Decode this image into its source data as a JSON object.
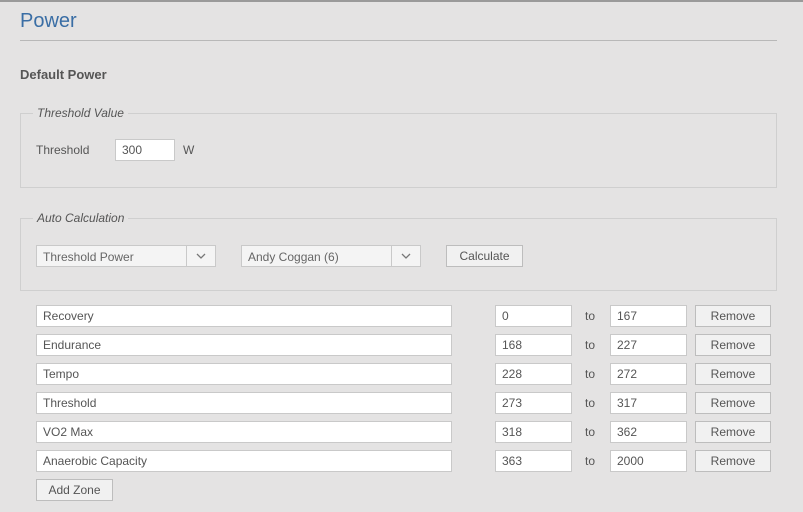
{
  "page": {
    "title": "Power"
  },
  "section": {
    "title": "Default Power"
  },
  "threshold": {
    "legend": "Threshold Value",
    "label": "Threshold",
    "value": "300",
    "unit": "W"
  },
  "auto_calc": {
    "legend": "Auto Calculation",
    "method_select": "Threshold Power",
    "model_select": "Andy Coggan (6)",
    "calculate_label": "Calculate"
  },
  "zones": [
    {
      "name": "Recovery",
      "from": "0",
      "to": "167"
    },
    {
      "name": "Endurance",
      "from": "168",
      "to": "227"
    },
    {
      "name": "Tempo",
      "from": "228",
      "to": "272"
    },
    {
      "name": "Threshold",
      "from": "273",
      "to": "317"
    },
    {
      "name": "VO2 Max",
      "from": "318",
      "to": "362"
    },
    {
      "name": "Anaerobic Capacity",
      "from": "363",
      "to": "2000"
    }
  ],
  "zone_to_label": "to",
  "remove_label": "Remove",
  "add_zone_label": "Add Zone",
  "icons": {
    "select_arrow": "chevron-down-icon"
  }
}
